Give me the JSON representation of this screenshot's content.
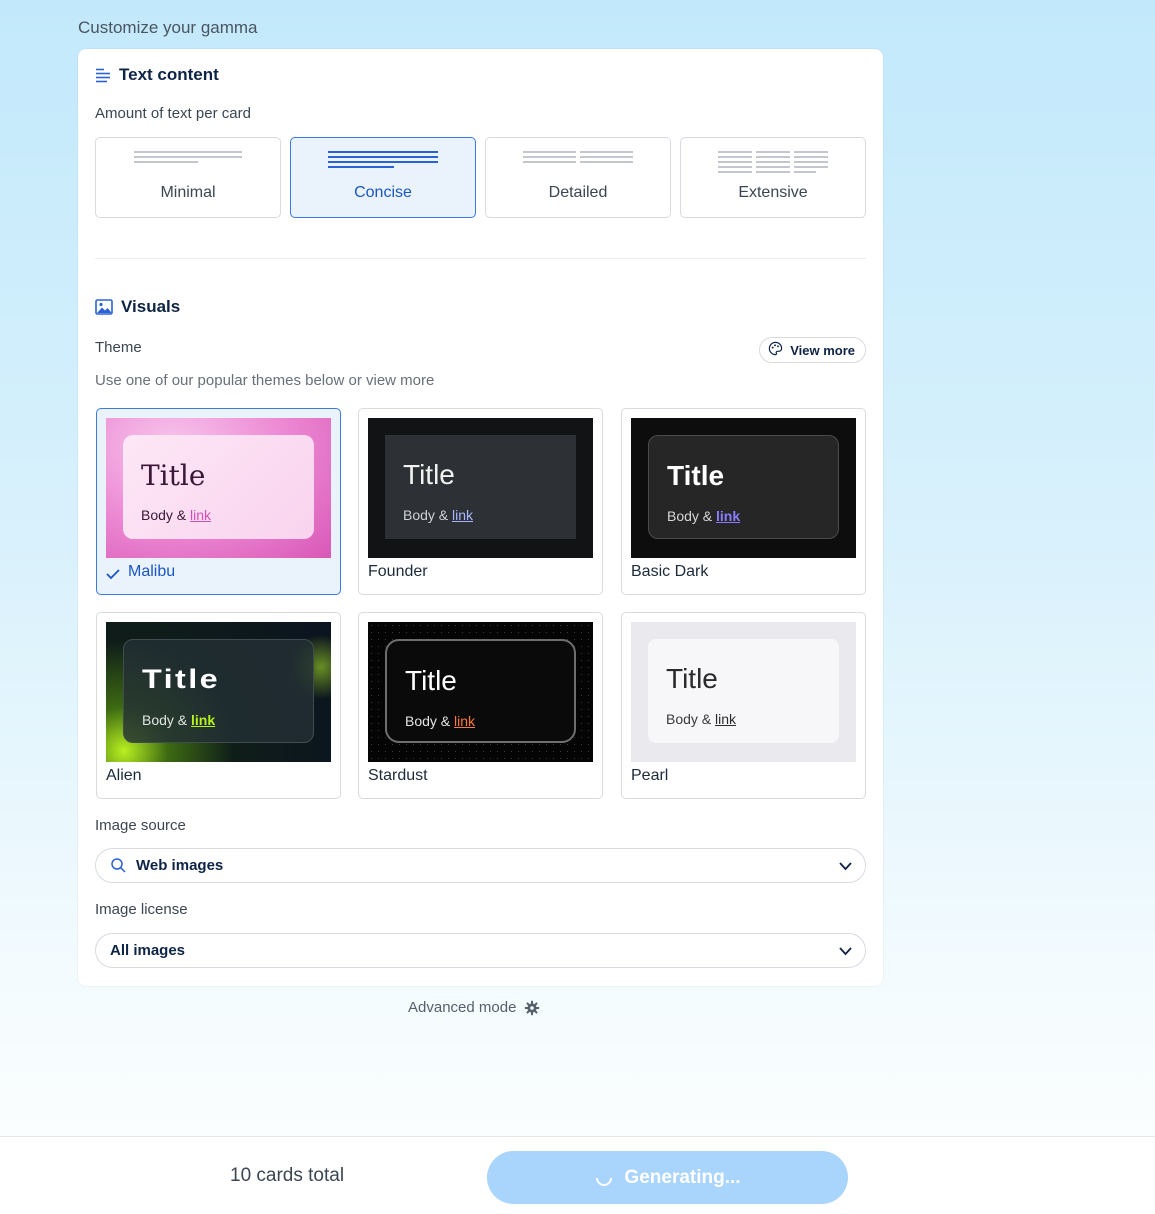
{
  "page": {
    "heading": "Customize your gamma"
  },
  "text_content": {
    "title": "Text content",
    "amount_label": "Amount of text per card",
    "options": [
      {
        "label": "Minimal",
        "selected": false
      },
      {
        "label": "Concise",
        "selected": true
      },
      {
        "label": "Detailed",
        "selected": false
      },
      {
        "label": "Extensive",
        "selected": false
      }
    ]
  },
  "visuals": {
    "title": "Visuals",
    "theme_label": "Theme",
    "view_more": "View more",
    "theme_hint": "Use one of our popular themes below or view more",
    "themes": [
      {
        "name": "Malibu",
        "selected": true,
        "title": "Title",
        "body": "Body &",
        "link": "link"
      },
      {
        "name": "Founder",
        "selected": false,
        "title": "Title",
        "body": "Body &",
        "link": "link"
      },
      {
        "name": "Basic Dark",
        "selected": false,
        "title": "Title",
        "body": "Body &",
        "link": "link"
      },
      {
        "name": "Alien",
        "selected": false,
        "title": "Title",
        "body": "Body &",
        "link": "link"
      },
      {
        "name": "Stardust",
        "selected": false,
        "title": "Title",
        "body": "Body &",
        "link": "link"
      },
      {
        "name": "Pearl",
        "selected": false,
        "title": "Title",
        "body": "Body &",
        "link": "link"
      }
    ],
    "image_source_label": "Image source",
    "image_source_value": "Web images",
    "image_license_label": "Image license",
    "image_license_value": "All images"
  },
  "advanced_mode": "Advanced mode",
  "footer": {
    "cards_total": "10 cards total",
    "generate_label": "Generating..."
  },
  "colors": {
    "accent": "#1a56c4",
    "selected_bg": "#eaf2fc",
    "button_disabled": "#a9d4fb"
  }
}
